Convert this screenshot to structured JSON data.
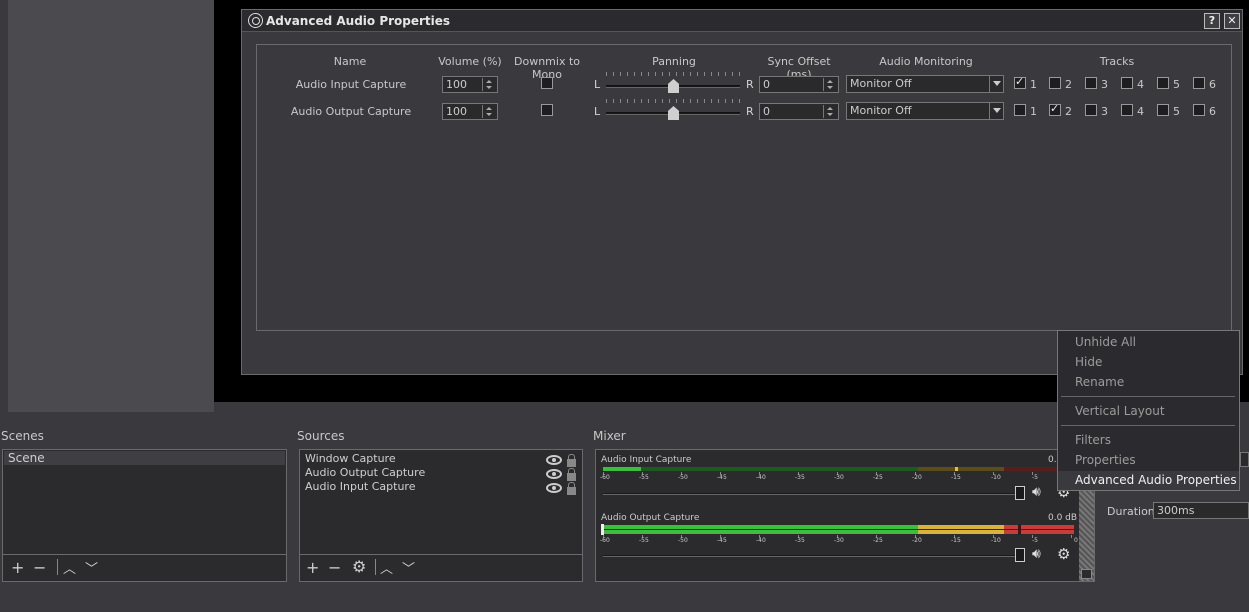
{
  "dialog": {
    "title": "Advanced Audio Properties",
    "help_label": "?",
    "close_label": "✕",
    "headers": {
      "name": "Name",
      "volume": "Volume (%)",
      "downmix": "Downmix to Mono",
      "panning": "Panning",
      "sync": "Sync Offset (ms)",
      "monitoring": "Audio Monitoring",
      "tracks": "Tracks"
    },
    "pan_left": "L",
    "pan_right": "R",
    "rows": [
      {
        "name": "Audio Input Capture",
        "volume": "100",
        "downmix": false,
        "pan": 0.5,
        "sync": "0",
        "monitoring": "Monitor Off",
        "tracks": [
          {
            "label": "1",
            "checked": true
          },
          {
            "label": "2",
            "checked": false
          },
          {
            "label": "3",
            "checked": false
          },
          {
            "label": "4",
            "checked": false
          },
          {
            "label": "5",
            "checked": false
          },
          {
            "label": "6",
            "checked": false
          }
        ]
      },
      {
        "name": "Audio Output Capture",
        "volume": "100",
        "downmix": false,
        "pan": 0.5,
        "sync": "0",
        "monitoring": "Monitor Off",
        "tracks": [
          {
            "label": "1",
            "checked": false
          },
          {
            "label": "2",
            "checked": true
          },
          {
            "label": "3",
            "checked": false
          },
          {
            "label": "4",
            "checked": false
          },
          {
            "label": "5",
            "checked": false
          },
          {
            "label": "6",
            "checked": false
          }
        ]
      }
    ]
  },
  "scenes": {
    "title": "Scenes",
    "items": [
      "Scene"
    ]
  },
  "sources": {
    "title": "Sources",
    "items": [
      "Window Capture",
      "Audio Output Capture",
      "Audio Input Capture"
    ]
  },
  "mixer": {
    "title": "Mixer",
    "channels": [
      {
        "name": "Audio Input Capture",
        "db": "0.0"
      },
      {
        "name": "Audio Output Capture",
        "db": "0.0 dB"
      }
    ],
    "scale": [
      "-60",
      "-55",
      "-50",
      "-45",
      "-40",
      "-35",
      "-30",
      "-25",
      "-20",
      "-15",
      "-10",
      "-5",
      "0"
    ]
  },
  "transitions": {
    "duration_label": "Duration",
    "duration_value": "300ms"
  },
  "context_menu": {
    "items": [
      "Unhide All",
      "Hide",
      "Rename",
      "Vertical Layout",
      "Filters",
      "Properties",
      "Advanced Audio Properties"
    ],
    "active": "Advanced Audio Properties"
  },
  "colors": {
    "meter_green": "#3cbf3c",
    "meter_yellow": "#d9b43c",
    "meter_red": "#c83c3c"
  }
}
